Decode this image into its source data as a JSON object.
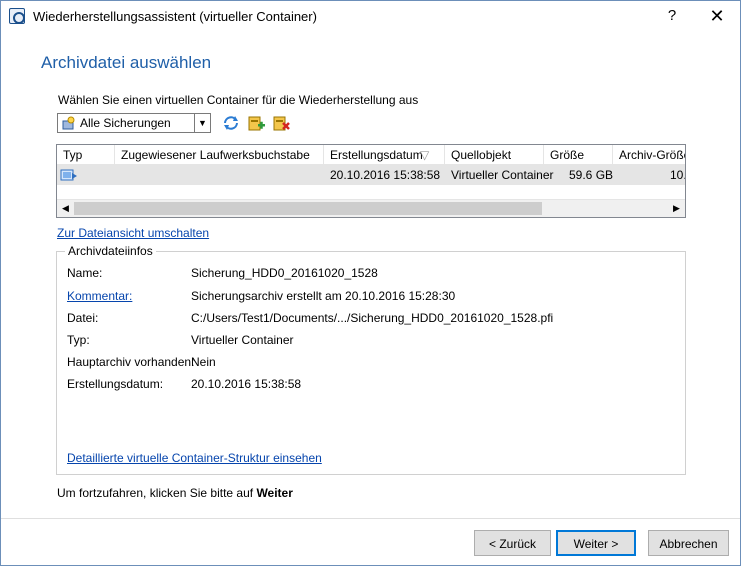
{
  "window": {
    "title": "Wiederherstellungsassistent (virtueller Container)",
    "help_glyph": "?",
    "close_glyph": "✕"
  },
  "page": {
    "heading": "Archivdatei auswählen",
    "prompt": "Wählen Sie einen virtuellen Container für die Wiederherstellung aus"
  },
  "toolbar": {
    "filter_value": "Alle Sicherungen",
    "icons": [
      "refresh-icon",
      "add-archive-icon",
      "remove-archive-icon"
    ]
  },
  "list": {
    "columns": [
      "Typ",
      "Zugewiesener Laufwerksbuchstabe",
      "Erstellungsdatum",
      "Quellobjekt",
      "Größe",
      "Archiv-Größe"
    ],
    "sort_glyph": "▽",
    "rows": [
      {
        "typ_icon": "virtual-container-icon",
        "laufwerk": "",
        "datum": "20.10.2016 15:38:58",
        "quelle": "Virtueller Container",
        "groesse": "59.6 GB",
        "archiv_groesse": "10."
      }
    ]
  },
  "toggle_link": "Zur Dateiansicht umschalten",
  "info": {
    "group_title": "Archivdateiinfos",
    "name_label": "Name:",
    "name_value": "Sicherung_HDD0_20161020_1528",
    "comment_label": "Kommentar:",
    "comment_value": "Sicherungsarchiv erstellt am 20.10.2016 15:28:30",
    "file_label": "Datei:",
    "file_value": "C:/Users/Test1/Documents/.../Sicherung_HDD0_20161020_1528.pfi",
    "type_label": "Typ:",
    "type_value": "Virtueller Container",
    "main_label": "Hauptarchiv vorhanden:",
    "main_value": "Nein",
    "date_label": "Erstellungsdatum:",
    "date_value": "20.10.2016 15:38:58",
    "detail_link": "Detaillierte virtuelle Container-Struktur einsehen"
  },
  "hint": {
    "prefix": "Um fortzufahren, klicken Sie bitte auf ",
    "bold": "Weiter"
  },
  "buttons": {
    "back": "< Zurück",
    "next": "Weiter >",
    "cancel": "Abbrechen"
  },
  "colors": {
    "accent": "#1f5fa8",
    "link": "#0645ad",
    "default_button_border": "#0078d7"
  }
}
